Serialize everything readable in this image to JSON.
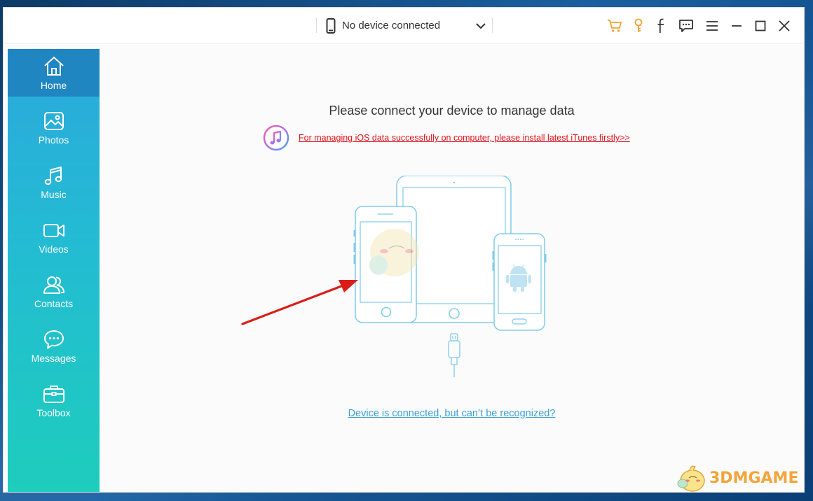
{
  "titlebar": {
    "device_label": "No device connected",
    "icons": [
      "cart-icon",
      "key-icon",
      "facebook-icon",
      "feedback-icon",
      "menu-icon",
      "minimize-icon",
      "maximize-icon",
      "close-icon"
    ]
  },
  "sidebar": {
    "items": [
      {
        "label": "Home",
        "icon": "home-icon",
        "active": true
      },
      {
        "label": "Photos",
        "icon": "photos-icon",
        "active": false
      },
      {
        "label": "Music",
        "icon": "music-icon",
        "active": false
      },
      {
        "label": "Videos",
        "icon": "videos-icon",
        "active": false
      },
      {
        "label": "Contacts",
        "icon": "contacts-icon",
        "active": false
      },
      {
        "label": "Messages",
        "icon": "messages-icon",
        "active": false
      },
      {
        "label": "Toolbox",
        "icon": "toolbox-icon",
        "active": false
      }
    ]
  },
  "main": {
    "headline": "Please connect your device to manage data",
    "itunes_link": "For managing iOS data successfully on computer, please install latest iTunes firstly>>",
    "help_link": "Device is connected, but can’t be recognized?"
  },
  "watermark": {
    "text": "3DMGAME"
  },
  "colors": {
    "sidebar_top": "#2ba8dc",
    "sidebar_bottom": "#1ecdbc",
    "sidebar_active": "#1f86c1",
    "accent_orange": "#f0a030",
    "link_red": "#e0121b",
    "link_blue": "#3aa0d4",
    "device_outline": "#7fcbea",
    "arrow_red": "#d91e18"
  }
}
